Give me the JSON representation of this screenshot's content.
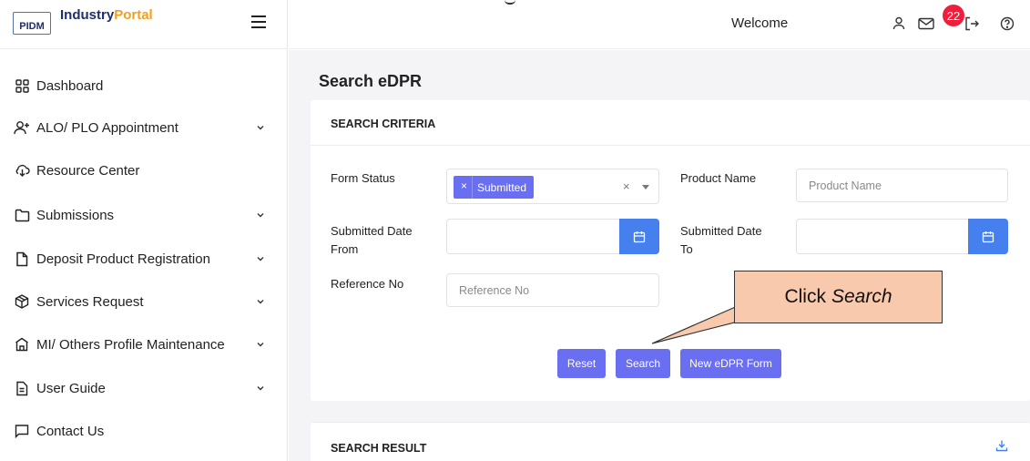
{
  "brand": {
    "logo_box": "PIDM",
    "name_part1": "Industry",
    "name_part2": "Portal"
  },
  "sidebar": {
    "items": [
      {
        "label": "Dashboard",
        "icon": "grid-icon",
        "has_submenu": false
      },
      {
        "label": "ALO/ PLO Appointment",
        "icon": "user-plus-icon",
        "has_submenu": true
      },
      {
        "label": "Resource Center",
        "icon": "cloud-download-icon",
        "has_submenu": false
      },
      {
        "label": "Submissions",
        "icon": "folder-icon",
        "has_submenu": true
      },
      {
        "label": "Deposit Product Registration",
        "icon": "file-icon",
        "has_submenu": true
      },
      {
        "label": "Services Request",
        "icon": "box-icon",
        "has_submenu": true
      },
      {
        "label": "MI/ Others Profile Maintenance",
        "icon": "bank-icon",
        "has_submenu": true
      },
      {
        "label": "User Guide",
        "icon": "document-icon",
        "has_submenu": true
      },
      {
        "label": "Contact Us",
        "icon": "message-icon",
        "has_submenu": false
      }
    ]
  },
  "header": {
    "welcome": "Welcome",
    "notification_count": "22",
    "icons": [
      "user-icon",
      "mail-icon",
      "logout-icon",
      "help-icon"
    ]
  },
  "page": {
    "title": "Search eDPR",
    "criteria": {
      "title": "SEARCH CRITERIA",
      "form_status_label": "Form Status",
      "form_status_selected": "Submitted",
      "form_status_clear": "×",
      "chip_remove": "×",
      "product_name_label": "Product Name",
      "product_name_placeholder": "Product Name",
      "submitted_from_label_1": "Submitted Date",
      "submitted_from_label_2": "From",
      "submitted_to_label_1": "Submitted Date",
      "submitted_to_label_2": "To",
      "reference_label": "Reference No",
      "reference_placeholder": "Reference No"
    },
    "buttons": {
      "reset": "Reset",
      "search": "Search",
      "new_form": "New eDPR Form"
    },
    "result": {
      "title": "SEARCH RESULT"
    }
  },
  "callout": {
    "prefix": "Click",
    "emphasis": "Search"
  },
  "colors": {
    "accent": "#6a6ff2",
    "calendar_button": "#4680ee",
    "badge": "#ef1f3c",
    "callout_fill": "#f8c9ad",
    "brand_navy": "#1f2f6a",
    "brand_orange": "#f0a020"
  }
}
